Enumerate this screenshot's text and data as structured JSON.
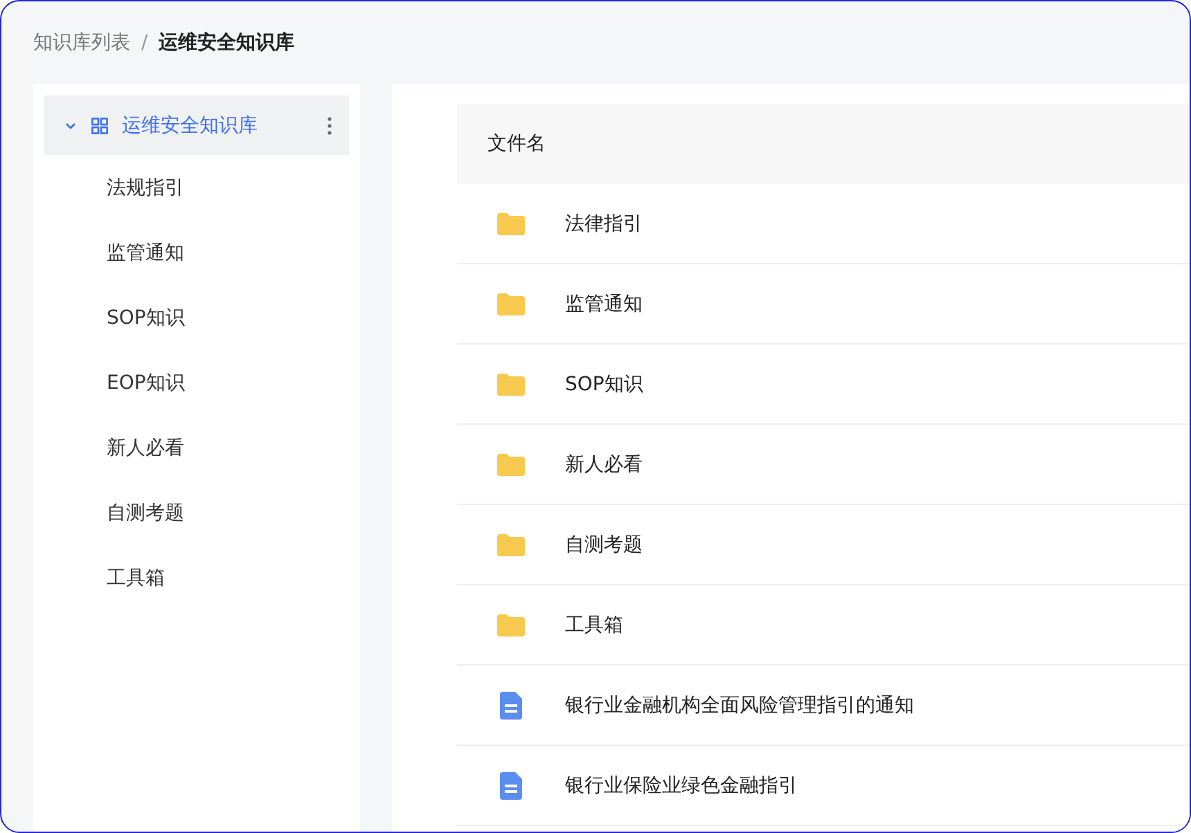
{
  "breadcrumb": [
    {
      "label": "知识库列表",
      "current": false
    },
    {
      "label": "运维安全知识库",
      "current": true
    }
  ],
  "separator": "/",
  "sidebar": {
    "tree": [
      {
        "label": "运维安全知识库",
        "selected": true,
        "expanded": true,
        "children": [
          {
            "label": "法规指引",
            "selected": false
          },
          {
            "label": "监管通知",
            "selected": false
          },
          {
            "label": "SOP知识",
            "selected": false
          },
          {
            "label": "EOP知识",
            "selected": false
          },
          {
            "label": "新人必看",
            "selected": false
          },
          {
            "label": "自测考题",
            "selected": false
          },
          {
            "label": "工具箱",
            "selected": false
          }
        ]
      }
    ]
  },
  "table": {
    "columns": [
      "文件名"
    ],
    "rows": [
      {
        "kind": "folder",
        "name": "法律指引"
      },
      {
        "kind": "folder",
        "name": "监管通知"
      },
      {
        "kind": "folder",
        "name": "SOP知识"
      },
      {
        "kind": "folder",
        "name": "新人必看"
      },
      {
        "kind": "folder",
        "name": "自测考题"
      },
      {
        "kind": "folder",
        "name": "工具箱"
      },
      {
        "kind": "document",
        "name": "银行业金融机构全面风险管理指引的通知"
      },
      {
        "kind": "document",
        "name": "银行业保险业绿色金融指引"
      }
    ]
  }
}
